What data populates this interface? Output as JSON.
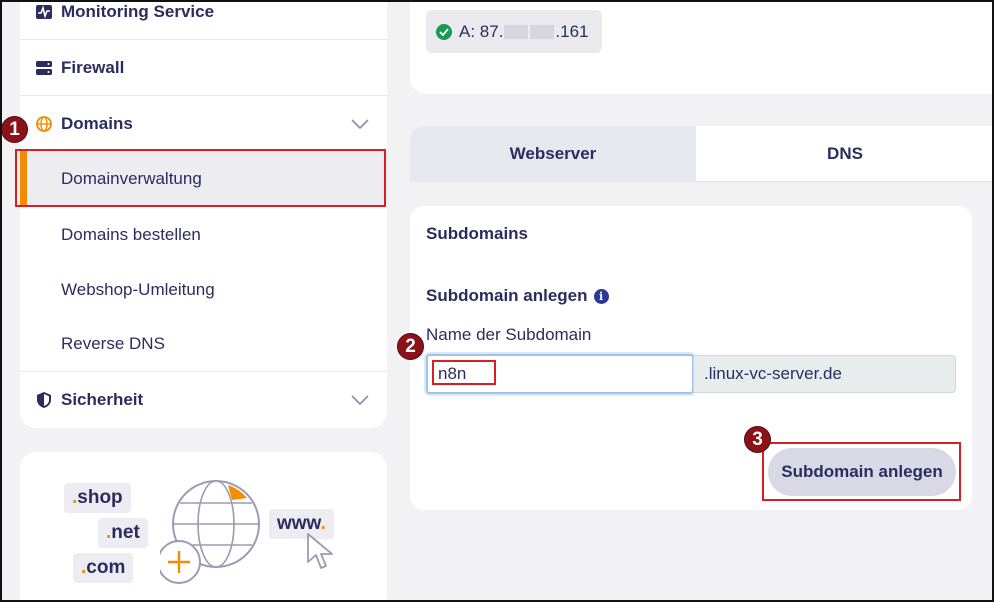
{
  "sidebar": {
    "items": [
      {
        "label": "Monitoring Service",
        "icon": "monitoring-icon"
      },
      {
        "label": "Firewall",
        "icon": "firewall-icon"
      },
      {
        "label": "Domains",
        "icon": "globe-icon",
        "expanded": true
      },
      {
        "label": "Sicherheit",
        "icon": "shield-icon"
      }
    ],
    "domain_subitems": [
      {
        "label": "Domainverwaltung",
        "active": true
      },
      {
        "label": "Domains bestellen"
      },
      {
        "label": "Webshop-Umleitung"
      },
      {
        "label": "Reverse DNS"
      }
    ]
  },
  "promo": {
    "tlds": [
      {
        "dot": ".",
        "text": "shop"
      },
      {
        "dot": ".",
        "text": "net"
      },
      {
        "dot": ".",
        "text": "com"
      },
      {
        "text": "www",
        "dot": "."
      }
    ]
  },
  "ip_record": {
    "prefix": "A: 87.",
    "suffix": ".161",
    "status": "check-icon"
  },
  "tabs": [
    {
      "label": "Webserver",
      "active": true
    },
    {
      "label": "DNS",
      "active": false
    }
  ],
  "form": {
    "section_title": "Subdomains",
    "create_title": "Subdomain anlegen",
    "info_glyph": "i",
    "field_label": "Name der Subdomain",
    "input_value": "n8n",
    "domain_suffix": ".linux-vc-server.de",
    "submit_label": "Subdomain anlegen"
  },
  "annotations": {
    "badges": [
      "1",
      "2",
      "3"
    ],
    "color": "#d91f26"
  },
  "colors": {
    "accent": "#f28c00",
    "text": "#2b2d5e",
    "success": "#1a9b52"
  }
}
